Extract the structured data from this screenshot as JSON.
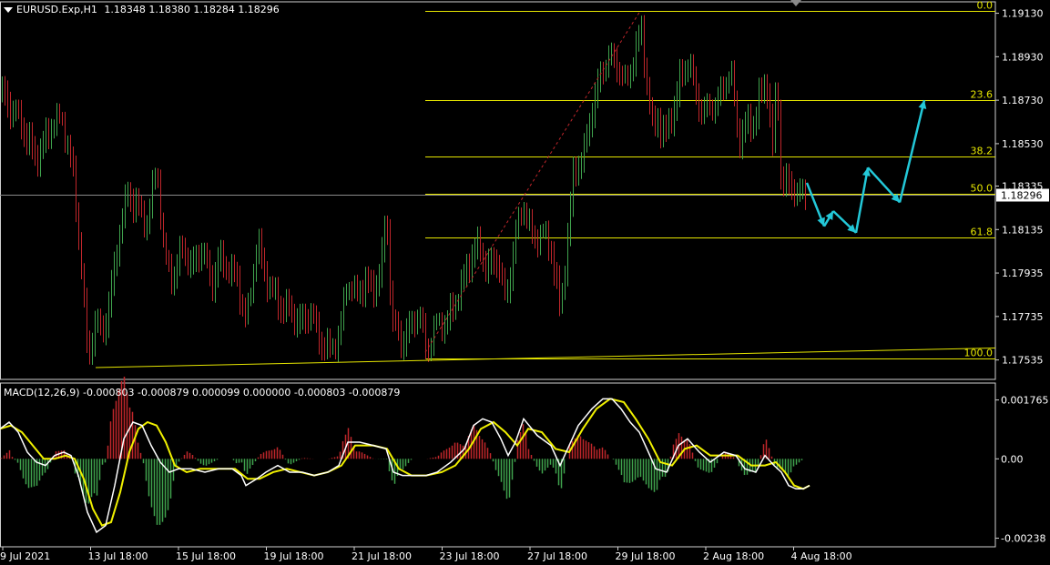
{
  "header": {
    "symbol": "EURUSD.Exp,H1",
    "ohlc": "1.18348 1.18380 1.18284 1.18296"
  },
  "macd_header": {
    "label": "MACD(12,26,9) -0.000803 -0.000879 0.000099 0.000000 -0.000803 -0.000879"
  },
  "colors": {
    "background": "#000000",
    "bull_candle": "#3fa34d",
    "bear_candle": "#c0262b",
    "fib_line": "#e5e500",
    "forecast_arrow": "#23c8d8",
    "price_line": "#8a8a8a",
    "macd_line": "#ffffff",
    "signal_line": "#f0f000",
    "axis_text": "#ffffff",
    "frame": "#cfcfcf"
  },
  "chart_data": [
    {
      "type": "candlestick",
      "title": "EURUSD.Exp,H1",
      "y_ticks": [
        "1.19130",
        "1.18930",
        "1.18730",
        "1.18530",
        "1.18335",
        "1.18135",
        "1.17935",
        "1.17735",
        "1.17535"
      ],
      "current_price": "1.18296",
      "x_ticks": [
        "9 Jul 2021",
        "13 Jul 18:00",
        "15 Jul 18:00",
        "19 Jul 18:00",
        "21 Jul 18:00",
        "23 Jul 18:00",
        "27 Jul 18:00",
        "29 Jul 18:00",
        "2 Aug 18:00",
        "4 Aug 18:00"
      ],
      "ylim": [
        1.175,
        1.1917
      ],
      "fibonacci": [
        {
          "level": "0.0",
          "price": 1.1914
        },
        {
          "level": "23.6",
          "price": 1.1873
        },
        {
          "level": "38.2",
          "price": 1.1847
        },
        {
          "level": "50.0",
          "price": 1.183
        },
        {
          "level": "61.8",
          "price": 1.181
        },
        {
          "level": "100.0",
          "price": 1.1754
        }
      ],
      "path": [
        [
          0,
          1.1877
        ],
        [
          10,
          1.187
        ],
        [
          25,
          1.186
        ],
        [
          40,
          1.1845
        ],
        [
          55,
          1.1862
        ],
        [
          68,
          1.1865
        ],
        [
          80,
          1.184
        ],
        [
          88,
          1.18
        ],
        [
          96,
          1.1755
        ],
        [
          104,
          1.177
        ],
        [
          112,
          1.1765
        ],
        [
          120,
          1.178
        ],
        [
          130,
          1.181
        ],
        [
          140,
          1.183
        ],
        [
          150,
          1.1825
        ],
        [
          160,
          1.1815
        ],
        [
          172,
          1.1845
        ],
        [
          180,
          1.18
        ],
        [
          190,
          1.1792
        ],
        [
          200,
          1.1805
        ],
        [
          210,
          1.1795
        ],
        [
          220,
          1.1805
        ],
        [
          232,
          1.1788
        ],
        [
          240,
          1.18
        ],
        [
          250,
          1.1795
        ],
        [
          260,
          1.1792
        ],
        [
          270,
          1.177
        ],
        [
          282,
          1.181
        ],
        [
          292,
          1.179
        ],
        [
          305,
          1.178
        ],
        [
          318,
          1.1775
        ],
        [
          330,
          1.177
        ],
        [
          340,
          1.1775
        ],
        [
          352,
          1.1762
        ],
        [
          362,
          1.1758
        ],
        [
          372,
          1.1765
        ],
        [
          380,
          1.179
        ],
        [
          390,
          1.1783
        ],
        [
          400,
          1.179
        ],
        [
          410,
          1.1785
        ],
        [
          418,
          1.1795
        ],
        [
          424,
          1.1823
        ],
        [
          430,
          1.177
        ],
        [
          440,
          1.1762
        ],
        [
          450,
          1.1768
        ],
        [
          460,
          1.1775
        ],
        [
          468,
          1.1758
        ],
        [
          478,
          1.177
        ],
        [
          490,
          1.1772
        ],
        [
          505,
          1.1785
        ],
        [
          515,
          1.18
        ],
        [
          525,
          1.1805
        ],
        [
          535,
          1.1795
        ],
        [
          545,
          1.18
        ],
        [
          555,
          1.178
        ],
        [
          565,
          1.181
        ],
        [
          575,
          1.1825
        ],
        [
          585,
          1.181
        ],
        [
          595,
          1.1812
        ],
        [
          605,
          1.1805
        ],
        [
          615,
          1.1775
        ],
        [
          622,
          1.1805
        ],
        [
          630,
          1.1842
        ],
        [
          640,
          1.1845
        ],
        [
          650,
          1.187
        ],
        [
          660,
          1.1885
        ],
        [
          668,
          1.1893
        ],
        [
          678,
          1.189
        ],
        [
          688,
          1.188
        ],
        [
          697,
          1.1898
        ],
        [
          704,
          1.1905
        ],
        [
          710,
          1.188
        ],
        [
          716,
          1.186
        ],
        [
          722,
          1.1865
        ],
        [
          730,
          1.1855
        ],
        [
          740,
          1.187
        ],
        [
          748,
          1.1885
        ],
        [
          756,
          1.189
        ],
        [
          764,
          1.1875
        ],
        [
          772,
          1.1868
        ],
        [
          782,
          1.187
        ],
        [
          792,
          1.1878
        ],
        [
          802,
          1.1888
        ],
        [
          810,
          1.1855
        ],
        [
          818,
          1.1862
        ],
        [
          826,
          1.186
        ],
        [
          834,
          1.1875
        ],
        [
          842,
          1.188
        ],
        [
          848,
          1.185
        ],
        [
          853,
          1.1885
        ],
        [
          856,
          1.184
        ],
        [
          862,
          1.1835
        ],
        [
          870,
          1.1832
        ],
        [
          878,
          1.183
        ],
        [
          886,
          1.183
        ]
      ],
      "forecast": [
        [
          886,
          1.1835
        ],
        [
          905,
          1.1815
        ],
        [
          915,
          1.1822
        ],
        [
          940,
          1.1812
        ],
        [
          953,
          1.1842
        ],
        [
          988,
          1.1826
        ],
        [
          1015,
          1.1873
        ]
      ],
      "trendlines": [
        {
          "from": [
            105,
            1.175
          ],
          "to": [
            1093,
            1.1759
          ],
          "style": "solid"
        },
        {
          "from": [
            467,
            1.1757
          ],
          "to": [
            703,
            1.1914
          ],
          "style": "dashed"
        }
      ]
    },
    {
      "type": "line",
      "title": "MACD(12,26,9)",
      "y_ticks": [
        "0.001765",
        "0.00",
        "-0.00238"
      ],
      "ylim": [
        -0.00242,
        0.002
      ],
      "histogram_color_rule": "positive=bear_candle, negative=bull_candle",
      "macd": [
        [
          0,
          0.0009
        ],
        [
          10,
          0.0011
        ],
        [
          20,
          0.0008
        ],
        [
          30,
          0.0002
        ],
        [
          40,
          -0.0001
        ],
        [
          50,
          -0.0002
        ],
        [
          60,
          0.0001
        ],
        [
          70,
          0.0002
        ],
        [
          78,
          0.0001
        ],
        [
          86,
          -0.0005
        ],
        [
          96,
          -0.0016
        ],
        [
          106,
          -0.0022
        ],
        [
          116,
          -0.002
        ],
        [
          126,
          -0.0008
        ],
        [
          136,
          0.0006
        ],
        [
          146,
          0.0011
        ],
        [
          156,
          0.001
        ],
        [
          166,
          0.0004
        ],
        [
          176,
          -0.0001
        ],
        [
          186,
          -0.0004
        ],
        [
          196,
          -0.0003
        ],
        [
          210,
          -0.0003
        ],
        [
          225,
          -0.0004
        ],
        [
          240,
          -0.0003
        ],
        [
          255,
          -0.0003
        ],
        [
          265,
          -0.0005
        ],
        [
          270,
          -0.0008
        ],
        [
          282,
          -0.0006
        ],
        [
          292,
          -0.0004
        ],
        [
          305,
          -0.0002
        ],
        [
          318,
          -0.0004
        ],
        [
          332,
          -0.0004
        ],
        [
          345,
          -0.0005
        ],
        [
          360,
          -0.0004
        ],
        [
          372,
          -0.0002
        ],
        [
          382,
          0.0005
        ],
        [
          395,
          0.0005
        ],
        [
          410,
          0.0004
        ],
        [
          424,
          0.0003
        ],
        [
          432,
          -0.0004
        ],
        [
          442,
          -0.0005
        ],
        [
          455,
          -0.0005
        ],
        [
          468,
          -0.0005
        ],
        [
          480,
          -0.0004
        ],
        [
          495,
          -0.0001
        ],
        [
          510,
          0.0003
        ],
        [
          520,
          0.001
        ],
        [
          530,
          0.0012
        ],
        [
          540,
          0.0011
        ],
        [
          550,
          0.0006
        ],
        [
          558,
          0.0001
        ],
        [
          566,
          0.0005
        ],
        [
          575,
          0.0012
        ],
        [
          590,
          0.0007
        ],
        [
          605,
          0.0004
        ],
        [
          615,
          -0.0002
        ],
        [
          625,
          0.0004
        ],
        [
          635,
          0.001
        ],
        [
          650,
          0.0015
        ],
        [
          662,
          0.0018
        ],
        [
          672,
          0.0018
        ],
        [
          682,
          0.0015
        ],
        [
          692,
          0.0011
        ],
        [
          702,
          0.0008
        ],
        [
          712,
          0.0002
        ],
        [
          720,
          -0.0003
        ],
        [
          732,
          -0.0004
        ],
        [
          745,
          0.0004
        ],
        [
          755,
          0.0006
        ],
        [
          768,
          0.0002
        ],
        [
          780,
          -0.0001
        ],
        [
          795,
          0.0002
        ],
        [
          808,
          0.0001
        ],
        [
          818,
          -0.0003
        ],
        [
          830,
          -0.0004
        ],
        [
          840,
          0.0001
        ],
        [
          850,
          -0.0002
        ],
        [
          858,
          -0.0004
        ],
        [
          866,
          -0.0008
        ],
        [
          874,
          -0.0009
        ],
        [
          882,
          -0.0009
        ],
        [
          889,
          -0.0008
        ]
      ],
      "signal": [
        [
          0,
          0.0009
        ],
        [
          12,
          0.001
        ],
        [
          24,
          0.0008
        ],
        [
          36,
          0.0004
        ],
        [
          48,
          0.0
        ],
        [
          60,
          0.0
        ],
        [
          72,
          0.0001
        ],
        [
          82,
          0.0
        ],
        [
          92,
          -0.0006
        ],
        [
          102,
          -0.0015
        ],
        [
          112,
          -0.002
        ],
        [
          122,
          -0.0019
        ],
        [
          132,
          -0.001
        ],
        [
          142,
          0.0002
        ],
        [
          152,
          0.0009
        ],
        [
          162,
          0.0011
        ],
        [
          172,
          0.001
        ],
        [
          182,
          0.0005
        ],
        [
          192,
          -0.0002
        ],
        [
          205,
          -0.0004
        ],
        [
          220,
          -0.0003
        ],
        [
          240,
          -0.0003
        ],
        [
          258,
          -0.0003
        ],
        [
          272,
          -0.0006
        ],
        [
          285,
          -0.0006
        ],
        [
          300,
          -0.0004
        ],
        [
          315,
          -0.0003
        ],
        [
          330,
          -0.0004
        ],
        [
          345,
          -0.0005
        ],
        [
          360,
          -0.0004
        ],
        [
          375,
          -0.0002
        ],
        [
          390,
          0.0004
        ],
        [
          410,
          0.0004
        ],
        [
          425,
          0.0003
        ],
        [
          438,
          -0.0003
        ],
        [
          452,
          -0.0005
        ],
        [
          468,
          -0.0005
        ],
        [
          485,
          -0.0004
        ],
        [
          500,
          -0.0002
        ],
        [
          515,
          0.0003
        ],
        [
          528,
          0.0009
        ],
        [
          542,
          0.0011
        ],
        [
          555,
          0.0008
        ],
        [
          568,
          0.0004
        ],
        [
          580,
          0.0009
        ],
        [
          595,
          0.0008
        ],
        [
          610,
          0.0003
        ],
        [
          625,
          0.0002
        ],
        [
          640,
          0.0009
        ],
        [
          655,
          0.0015
        ],
        [
          670,
          0.0018
        ],
        [
          685,
          0.0017
        ],
        [
          698,
          0.0012
        ],
        [
          712,
          0.0006
        ],
        [
          725,
          -0.0001
        ],
        [
          738,
          -0.0002
        ],
        [
          752,
          0.0003
        ],
        [
          765,
          0.0004
        ],
        [
          780,
          0.0001
        ],
        [
          795,
          0.0001
        ],
        [
          810,
          0.0001
        ],
        [
          825,
          -0.0002
        ],
        [
          840,
          -0.0002
        ],
        [
          852,
          -0.0001
        ],
        [
          862,
          -0.0004
        ],
        [
          872,
          -0.0008
        ],
        [
          882,
          -0.0009
        ],
        [
          889,
          -0.0008
        ]
      ]
    }
  ]
}
